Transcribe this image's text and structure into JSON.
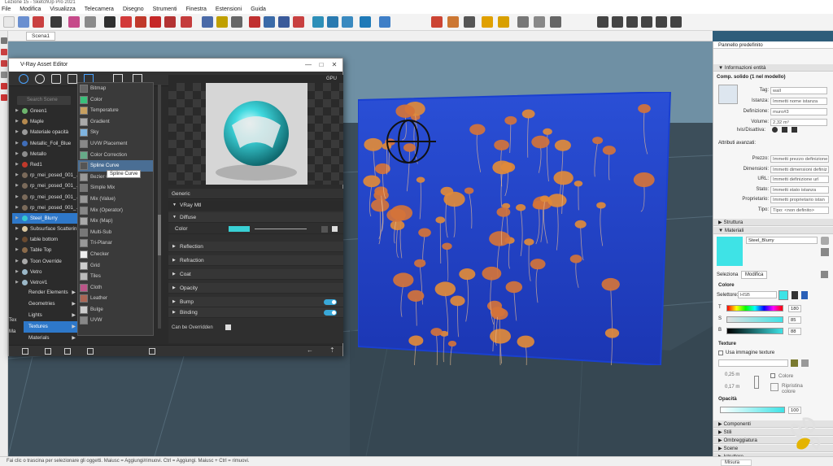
{
  "app": {
    "window_title": "Lezione 15 - SketchUp Pro 2021",
    "menu": [
      "File",
      "Modifica",
      "Visualizza",
      "Telecamera",
      "Disegno",
      "Strumenti",
      "Finestra",
      "Estensioni",
      "Guida"
    ],
    "scene_tab": "Scena1",
    "status_text": "Fai clic o trascina per selezionare gli oggetti. Maiusc = Aggiungi/rimuovi. Ctrl = Aggiungi. Maiusc + Ctrl = rimuovi.",
    "measure_label": "Misura"
  },
  "vray": {
    "title": "V-Ray Asset Editor",
    "search_placeholder": "Search Scene",
    "assets": [
      {
        "name": "Green1",
        "color": "#6db56d"
      },
      {
        "name": "Maple",
        "color": "#b58a4f"
      },
      {
        "name": "Materiale opacità",
        "color": "#9a9a9a"
      },
      {
        "name": "Metallic_Foil_Blue",
        "color": "#3f6db8"
      },
      {
        "name": "Metallo",
        "color": "#8c8c8c"
      },
      {
        "name": "Red1",
        "color": "#c0392b"
      },
      {
        "name": "rp_mei_posed_001_..",
        "color": "#7a6a5a"
      },
      {
        "name": "rp_mei_posed_001_..",
        "color": "#7a6a5a"
      },
      {
        "name": "rp_mei_posed_001_..",
        "color": "#7a6a5a"
      },
      {
        "name": "rp_mei_posed_001_..",
        "color": "#7a6a5a"
      },
      {
        "name": "Steel_Blurry",
        "color": "#36c8d0"
      },
      {
        "name": "Subsurface Scatterin",
        "color": "#d9c7a0"
      },
      {
        "name": "table bottom",
        "color": "#6a4a30"
      },
      {
        "name": "Table Top",
        "color": "#8a6a4a"
      },
      {
        "name": "Toon Override",
        "color": "#aaaaaa"
      },
      {
        "name": "Vetro",
        "color": "#9bb8c8"
      },
      {
        "name": "Vetro#1",
        "color": "#9bb8c8"
      }
    ],
    "categories": [
      "Render Elements",
      "Geometries",
      "Lights",
      "Textures",
      "Materials"
    ],
    "left_labels": [
      "Tex",
      "Ma"
    ],
    "textures": [
      "Bitmap",
      "Color",
      "Temperature",
      "Gradient",
      "Sky",
      "UVW Placement",
      "Color Correction",
      "Spline Curve",
      "Bezier Curve",
      "Simple Mix",
      "Mix (Value)",
      "Mix (Operator)",
      "Mix (Map)",
      "Multi-Sub",
      "Tri-Planar",
      "Checker",
      "Grid",
      "Tiles",
      "Cloth",
      "Leather",
      "Bulge",
      "UVW"
    ],
    "tooltip": "Spline Curve",
    "gpu_label": "GPU",
    "generic_label": "Generic",
    "material_type": "VRay Mtl",
    "diffuse_label": "Diffuse",
    "color_label": "Color",
    "sections": [
      "Reflection",
      "Refraction",
      "Coat",
      "Opacity",
      "Bump",
      "Binding"
    ],
    "can_be_overridden": "Can be Overridden",
    "diffuse_color": "#39d0d4"
  },
  "panel": {
    "tray_title": "Pannello predefinito",
    "info_header": "Informazioni entità",
    "info_sub": "Comp. solido (1 nel modello)",
    "fields": [
      {
        "label": "Tag:",
        "value": "wall"
      },
      {
        "label": "Istanza:",
        "value": "Immetti nome istanza"
      },
      {
        "label": "Definizione:",
        "value": "muro#3"
      },
      {
        "label": "Volume:",
        "value": "2,32 m³"
      }
    ],
    "visibility_label": "Ivis/Disattiva:",
    "advanced_label": "Attributi avanzati:",
    "adv_fields": [
      {
        "label": "Prezzo:",
        "value": "Immetti prezzo definizione"
      },
      {
        "label": "Dimensioni:",
        "value": "Immetti dimensioni definiz"
      },
      {
        "label": "URL:",
        "value": "Immetti definizione url"
      },
      {
        "label": "Stato:",
        "value": "Immetti stato istanza"
      },
      {
        "label": "Proprietario:",
        "value": "Immetti proprietario istan"
      },
      {
        "label": "Tipo:",
        "value": "Tipo: <non definito>"
      }
    ],
    "struttura": "Struttura",
    "materiali": "Materiali",
    "material_name": "Steel_Blurry",
    "material_color": "#3ee3e6",
    "tab_select": "Seleziona",
    "tab_edit": "Modifica",
    "colore_label": "Colore",
    "selettore_label": "Selettore:",
    "selettore_value": "HSB",
    "hsb": [
      {
        "ch": "T",
        "value": "180"
      },
      {
        "ch": "S",
        "value": "85"
      },
      {
        "ch": "B",
        "value": "88"
      }
    ],
    "texture_label": "Texture",
    "use_texture": "Usa immagine texture",
    "dim_w": "0,25 m",
    "dim_h": "0,17 m",
    "colore_check": "Colore",
    "ripristina": "Ripristina colore",
    "opacita_label": "Opacità",
    "opacity_value": "100",
    "bottom_sections": [
      "Componenti",
      "Stili",
      "Ombreggiatura",
      "Scene",
      "Istruttore"
    ]
  }
}
